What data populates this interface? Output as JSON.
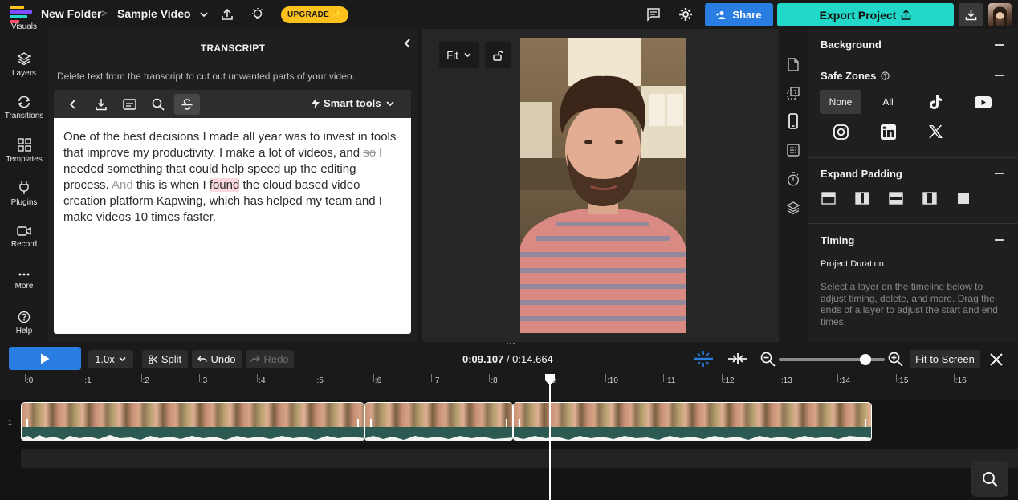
{
  "header": {
    "folder": "New Folder",
    "project_name": "Sample Video",
    "upgrade_label": "UPGRADE ✨",
    "share_label": "Share",
    "export_label": "Export Project"
  },
  "sidebar": {
    "items": [
      {
        "label": "Visuals",
        "icon": "visuals-icon"
      },
      {
        "label": "Layers",
        "icon": "layers-icon"
      },
      {
        "label": "Transitions",
        "icon": "transitions-icon"
      },
      {
        "label": "Templates",
        "icon": "templates-icon"
      },
      {
        "label": "Plugins",
        "icon": "plugins-icon"
      },
      {
        "label": "Record",
        "icon": "record-icon"
      },
      {
        "label": "More",
        "icon": "more-icon"
      },
      {
        "label": "Help",
        "icon": "help-icon"
      }
    ]
  },
  "transcript": {
    "title": "TRANSCRIPT",
    "description": "Delete text from the transcript to cut out unwanted parts of your video.",
    "smart_tools_label": "Smart tools",
    "segments": {
      "s1": "One of the best decisions I made all year was to invest in tools that improve my productivity. I make a lot of videos, and ",
      "strike1": "so",
      "s2": " I needed something that could help speed up the editing process. ",
      "strike2": "And",
      "s3": " this is when I ",
      "highlight": "found",
      "s4": " the cloud based video creation platform Kapwing, which has helped my team and I make videos 10 times faster."
    }
  },
  "preview": {
    "fit_label": "Fit"
  },
  "right_panel": {
    "background_title": "Background",
    "safe_zones_title": "Safe Zones",
    "safe_zones": {
      "none_label": "None",
      "all_label": "All",
      "selected": "None"
    },
    "expand_padding_title": "Expand Padding",
    "timing_title": "Timing",
    "project_duration_label": "Project Duration",
    "timing_help": "Select a layer on the timeline below to adjust timing, delete, and more. Drag the ends of a layer to adjust the start and end times."
  },
  "controls": {
    "speed_label": "1.0x",
    "split_label": "Split",
    "undo_label": "Undo",
    "redo_label": "Redo",
    "current_time": "0:09.107",
    "separator": " / ",
    "total_time": "0:14.664",
    "fit_screen_label": "Fit to Screen",
    "zoom_level": 0.82
  },
  "timeline": {
    "track_number": "1",
    "ticks": [
      ":0",
      ":1",
      ":2",
      ":3",
      ":4",
      ":5",
      ":6",
      ":7",
      ":8",
      ":9",
      ":10",
      ":11",
      ":12",
      ":13",
      ":14",
      ":15",
      ":16"
    ],
    "playhead_seconds": 9.107
  }
}
